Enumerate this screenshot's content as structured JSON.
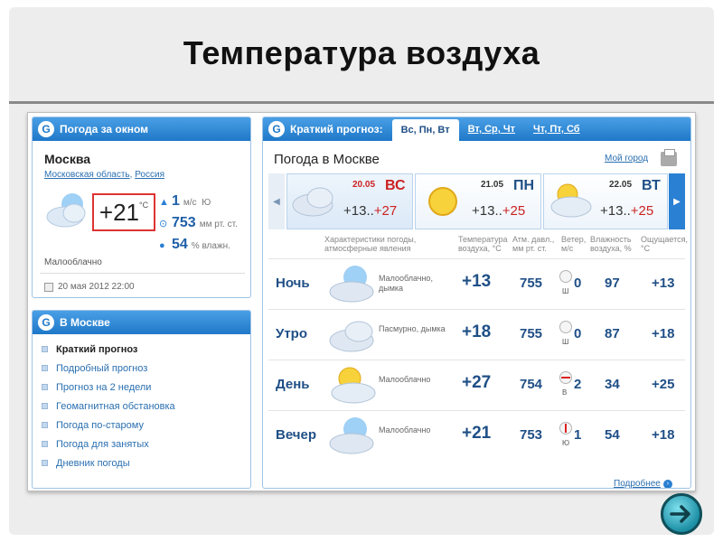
{
  "slide": {
    "title": "Температура воздуха"
  },
  "now": {
    "header": "Погода за окном",
    "city": "Москва",
    "region": "Московская область",
    "country": "Россия",
    "temp": "+21",
    "temp_unit": "°C",
    "wind": {
      "value": "1",
      "unit": "м/с",
      "dir": "Ю"
    },
    "pressure": {
      "value": "753",
      "unit": "мм рт. ст."
    },
    "humidity": {
      "value": "54",
      "unit": "% влажн."
    },
    "condition": "Малооблачно",
    "timestamp": "20 мая 2012 22:00"
  },
  "moscow": {
    "header": "В Москве",
    "links": [
      "Краткий прогноз",
      "Подробный прогноз",
      "Прогноз на 2 недели",
      "Геомагнитная обстановка",
      "Погода по-старому",
      "Погода для занятых",
      "Дневник погоды"
    ]
  },
  "forecast": {
    "header": "Краткий прогноз:",
    "tabs": [
      "Вс, Пн, Вт",
      "Вт, Ср, Чт",
      "Чт, Пт, Сб"
    ],
    "title": "Погода в Москве",
    "my_city": "Мой город",
    "days": [
      {
        "date": "20.05",
        "name": "ВС",
        "lo": "+13",
        "hi": "+27",
        "icon": "cloud-icon"
      },
      {
        "date": "21.05",
        "name": "ПН",
        "lo": "+13",
        "hi": "+25",
        "icon": "sun-icon"
      },
      {
        "date": "22.05",
        "name": "ВТ",
        "lo": "+13",
        "hi": "+25",
        "icon": "sun-cloud-icon"
      }
    ],
    "separator": "..",
    "columns": {
      "conditions": "Характеристики погоды, атмосферные явления",
      "temp": "Температура воздуха, °C",
      "pressure": "Атм. давл., мм рт. ст.",
      "wind": "Ветер, м/с",
      "humidity": "Влажность воздуха, %",
      "feels": "Ощущается, °C"
    },
    "rows": [
      {
        "name": "Ночь",
        "cond": "Малооблачно, дымка",
        "temp": "+13",
        "press": "755",
        "wind_dir": "Ш",
        "wind": "0",
        "hum": "97",
        "feels": "+13"
      },
      {
        "name": "Утро",
        "cond": "Пасмурно, дымка",
        "temp": "+18",
        "press": "755",
        "wind_dir": "Ш",
        "wind": "0",
        "hum": "87",
        "feels": "+18"
      },
      {
        "name": "День",
        "cond": "Малооблачно",
        "temp": "+27",
        "press": "754",
        "wind_dir": "В",
        "wind": "2",
        "hum": "34",
        "feels": "+25"
      },
      {
        "name": "Вечер",
        "cond": "Малооблачно",
        "temp": "+21",
        "press": "753",
        "wind_dir": "Ю",
        "wind": "1",
        "hum": "54",
        "feels": "+18"
      }
    ],
    "more": "Подробнее"
  },
  "colors": {
    "accent": "#1f78c8",
    "link": "#2a6fb0",
    "value": "#1f4f86",
    "hi_temp": "#cc2222",
    "highlight_border": "#dd3333"
  }
}
